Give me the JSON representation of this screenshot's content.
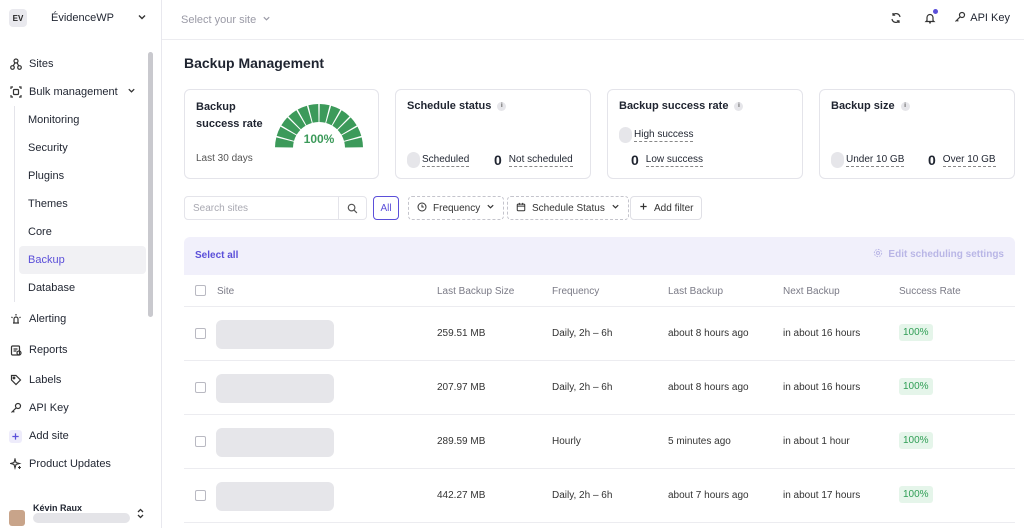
{
  "workspace": {
    "initials": "EV",
    "name": "ÉvidenceWP"
  },
  "topbar": {
    "site_placeholder": "Select your site",
    "api_key_label": "API Key"
  },
  "nav": {
    "sites": "Sites",
    "bulk": "Bulk management",
    "sub": [
      "Monitoring",
      "Security",
      "Plugins",
      "Themes",
      "Core",
      "Backup",
      "Database"
    ],
    "alerting": "Alerting",
    "reports": "Reports",
    "labels": "Labels",
    "api_key": "API Key",
    "add_site": "Add site",
    "product_updates": "Product Updates"
  },
  "user": {
    "name": "Kévin Raux"
  },
  "page": {
    "title": "Backup Management"
  },
  "cards": {
    "rate": {
      "title": "Backup success rate",
      "period": "Last 30 days",
      "value": "100%",
      "fraction": 1.0
    },
    "schedule": {
      "title": "Schedule status",
      "scheduled": "Scheduled",
      "not_scheduled_count": "0",
      "not_scheduled": "Not scheduled"
    },
    "success": {
      "title": "Backup success rate",
      "high": "High success",
      "low_count": "0",
      "low": "Low success"
    },
    "size": {
      "title": "Backup size",
      "under": "Under 10 GB",
      "over_count": "0",
      "over": "Over 10 GB"
    }
  },
  "filters": {
    "search_placeholder": "Search sites",
    "all": "All",
    "frequency": "Frequency",
    "schedule_status": "Schedule Status",
    "add_filter": "Add filter"
  },
  "table": {
    "select_all": "Select all",
    "edit_settings": "Edit scheduling settings",
    "headers": [
      "Site",
      "Last Backup Size",
      "Frequency",
      "Last Backup",
      "Next Backup",
      "Success Rate"
    ],
    "rows": [
      {
        "size": "259.51 MB",
        "frequency": "Daily, 2h – 6h",
        "last": "about 8 hours ago",
        "next": "in about 16 hours",
        "rate": "100%"
      },
      {
        "size": "207.97 MB",
        "frequency": "Daily, 2h – 6h",
        "last": "about 8 hours ago",
        "next": "in about 16 hours",
        "rate": "100%"
      },
      {
        "size": "289.59 MB",
        "frequency": "Hourly",
        "last": "5 minutes ago",
        "next": "in about 1 hour",
        "rate": "100%"
      },
      {
        "size": "442.27 MB",
        "frequency": "Daily, 2h – 6h",
        "last": "about 7 hours ago",
        "next": "in about 17 hours",
        "rate": "100%"
      }
    ]
  },
  "colors": {
    "accent": "#5b4fd9",
    "success": "#2f9e55",
    "gauge": "#3c9a5a"
  }
}
